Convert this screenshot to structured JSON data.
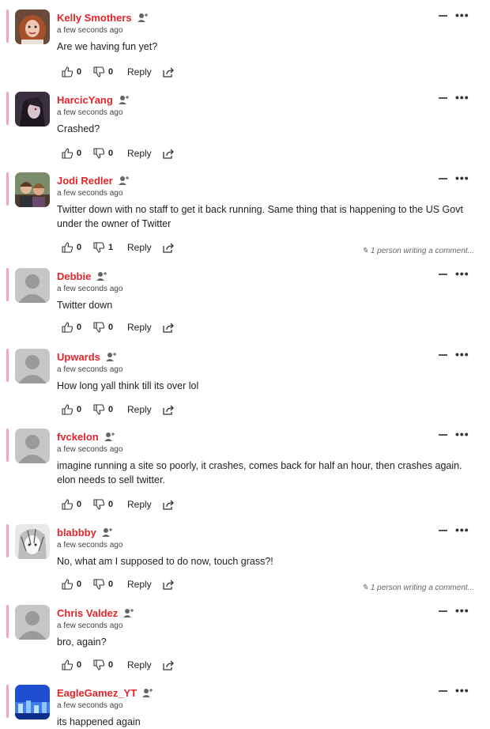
{
  "comments": [
    {
      "author": "Kelly Smothers",
      "time": "a few seconds ago",
      "text": "Are we having fun yet?",
      "likes": "0",
      "dislikes": "0",
      "reply_label": "Reply",
      "avatar": "photo-red-hair-icon"
    },
    {
      "author": "HarcicYang",
      "time": "a few seconds ago",
      "text": "Crashed?",
      "likes": "0",
      "dislikes": "0",
      "reply_label": "Reply",
      "avatar": "anime-dark-icon"
    },
    {
      "author": "Jodi Redler",
      "time": "a few seconds ago",
      "text": "Twitter down with no staff to get it back running. Same thing that is happening to the US Govt under the owner of Twitter",
      "likes": "0",
      "dislikes": "1",
      "reply_label": "Reply",
      "avatar": "photo-group-icon",
      "writing": "1 person writing a comment..."
    },
    {
      "author": "Debbie",
      "time": "a few seconds ago",
      "text": "Twitter down",
      "likes": "0",
      "dislikes": "0",
      "reply_label": "Reply",
      "avatar": "default-user-icon"
    },
    {
      "author": "Upwards",
      "time": "a few seconds ago",
      "text": "How long yall think till its over lol",
      "likes": "0",
      "dislikes": "0",
      "reply_label": "Reply",
      "avatar": "default-user-icon"
    },
    {
      "author": "fvckelon",
      "time": "a few seconds ago",
      "text": "imagine running a site so poorly, it crashes, comes back for half an hour, then crashes again. elon needs to sell twitter.",
      "likes": "0",
      "dislikes": "0",
      "reply_label": "Reply",
      "avatar": "default-user-icon"
    },
    {
      "author": "blabbby",
      "time": "a few seconds ago",
      "text": "No, what am I supposed to do now, touch grass?!",
      "likes": "0",
      "dislikes": "0",
      "reply_label": "Reply",
      "avatar": "anime-sketch-icon",
      "writing": "1 person writing a comment..."
    },
    {
      "author": "Chris Valdez",
      "time": "a few seconds ago",
      "text": "bro, again?",
      "likes": "0",
      "dislikes": "0",
      "reply_label": "Reply",
      "avatar": "default-user-icon"
    },
    {
      "author": "EagleGamez_YT",
      "time": "a few seconds ago",
      "text": "its happened again",
      "likes": "",
      "dislikes": "",
      "reply_label": "",
      "avatar": "pixel-blue-icon"
    }
  ],
  "colors": {
    "author": "#e4242b",
    "accent": "#f3a8b4"
  }
}
